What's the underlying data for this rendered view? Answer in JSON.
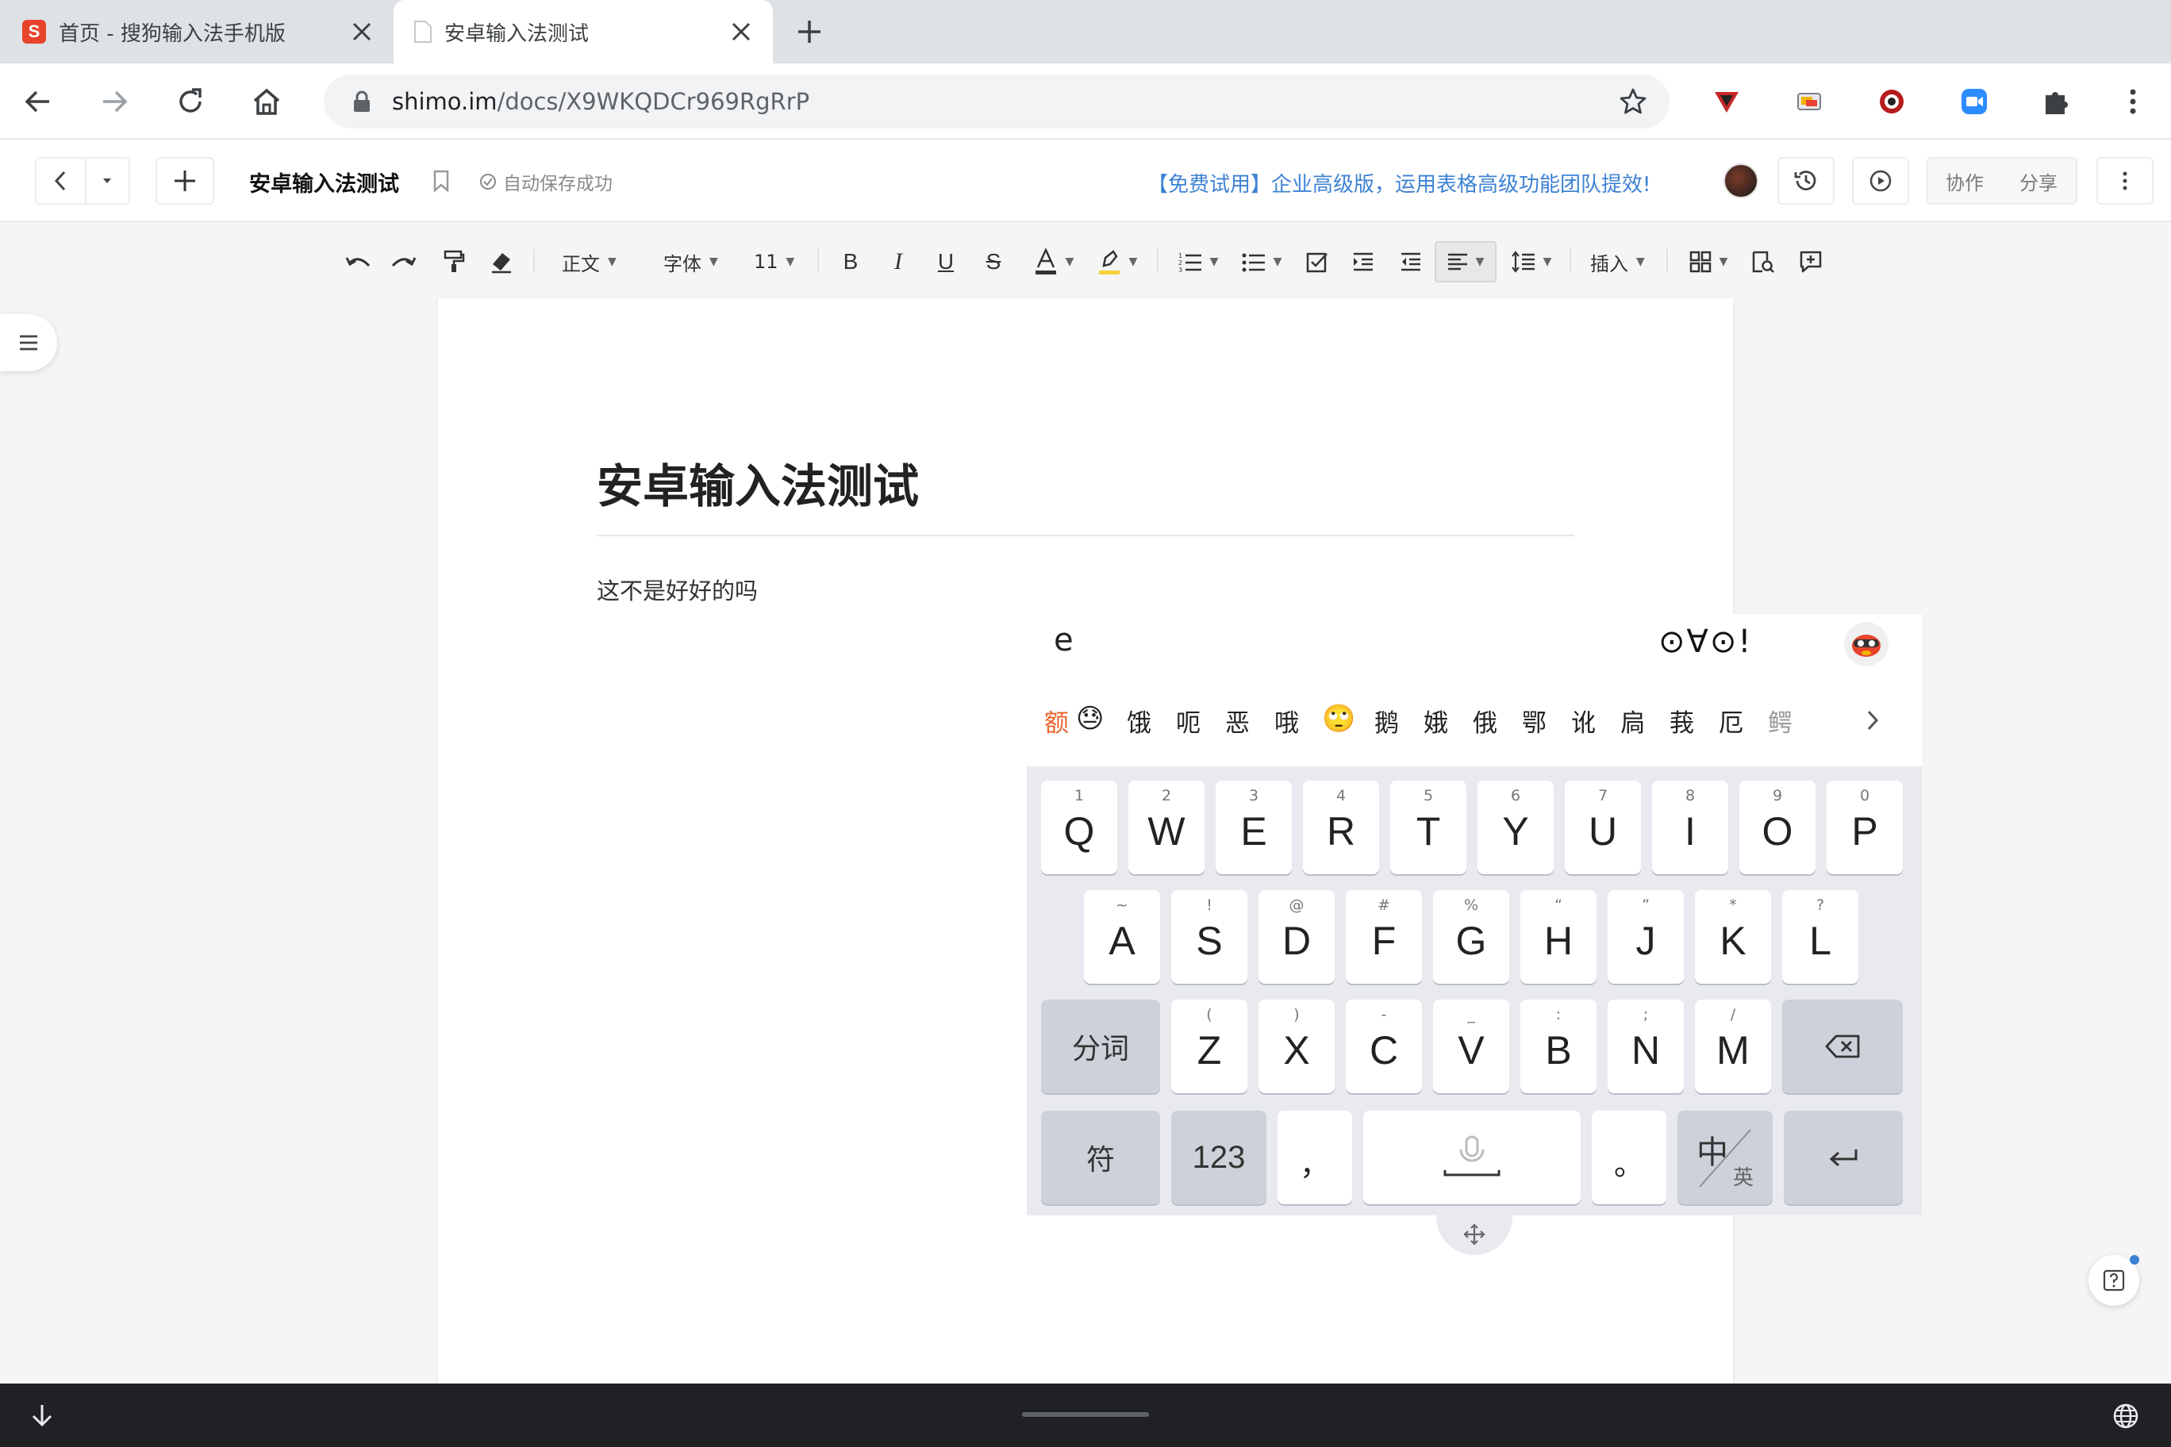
{
  "browser": {
    "tabs": [
      {
        "title": "首页 - 搜狗输入法手机版",
        "active": false
      },
      {
        "title": "安卓输入法测试",
        "active": true
      }
    ],
    "url_host": "shimo.im",
    "url_path": "/docs/X9WKQDCr969RgRrP"
  },
  "doc_header": {
    "title": "安卓输入法测试",
    "save_status": "自动保存成功",
    "promo": "【免费试用】企业高级版，运用表格高级功能团队提效!",
    "collab_label": "协作",
    "share_label": "分享"
  },
  "format_bar": {
    "style_label": "正文",
    "font_label": "字体",
    "size_label": "11",
    "insert_label": "插入"
  },
  "document": {
    "heading": "安卓输入法测试",
    "body": "这不是好好的吗"
  },
  "keyboard": {
    "composing": "e",
    "kaomoji": "⊙∀⊙!",
    "candidates": [
      "额",
      "😓",
      "饿",
      "呃",
      "恶",
      "哦",
      "🙄",
      "鹅",
      "娥",
      "俄",
      "鄂",
      "讹",
      "扃",
      "莪",
      "厄",
      "鳄"
    ],
    "row1": [
      {
        "key": "Q",
        "sub": "1"
      },
      {
        "key": "W",
        "sub": "2"
      },
      {
        "key": "E",
        "sub": "3"
      },
      {
        "key": "R",
        "sub": "4"
      },
      {
        "key": "T",
        "sub": "5"
      },
      {
        "key": "Y",
        "sub": "6"
      },
      {
        "key": "U",
        "sub": "7"
      },
      {
        "key": "I",
        "sub": "8"
      },
      {
        "key": "O",
        "sub": "9"
      },
      {
        "key": "P",
        "sub": "0"
      }
    ],
    "row2": [
      {
        "key": "A",
        "sub": "~"
      },
      {
        "key": "S",
        "sub": "!"
      },
      {
        "key": "D",
        "sub": "@"
      },
      {
        "key": "F",
        "sub": "#"
      },
      {
        "key": "G",
        "sub": "%"
      },
      {
        "key": "H",
        "sub": "“"
      },
      {
        "key": "J",
        "sub": "”"
      },
      {
        "key": "K",
        "sub": "*"
      },
      {
        "key": "L",
        "sub": "?"
      }
    ],
    "row3": [
      {
        "key": "Z",
        "sub": "("
      },
      {
        "key": "X",
        "sub": ")"
      },
      {
        "key": "C",
        "sub": "-"
      },
      {
        "key": "V",
        "sub": "_"
      },
      {
        "key": "B",
        "sub": ":"
      },
      {
        "key": "N",
        "sub": ";"
      },
      {
        "key": "M",
        "sub": "/"
      }
    ],
    "split_label": "分词",
    "symbol_label": "符",
    "num_label": "123",
    "comma_label": "，",
    "period_label": "。",
    "lang_zh": "中",
    "lang_en": "英"
  },
  "colors": {
    "accent": "#3d82d4",
    "candidate_highlight": "#e8622c"
  }
}
